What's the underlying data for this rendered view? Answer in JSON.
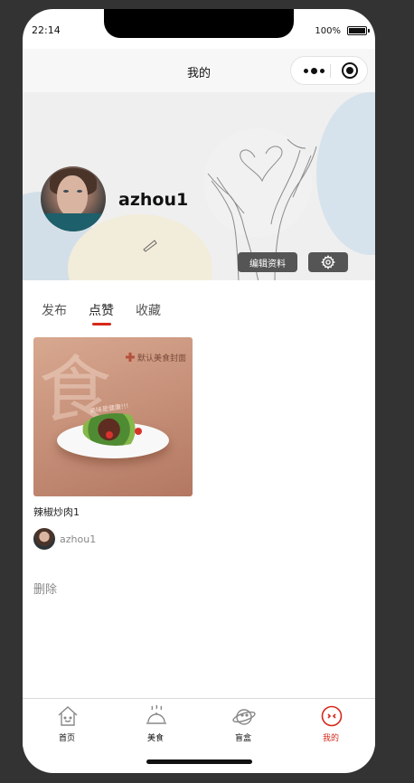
{
  "status_bar": {
    "time": "22:14",
    "battery": "100%"
  },
  "navbar": {
    "title": "我的"
  },
  "profile": {
    "username": "azhou1",
    "edit_button": "编辑资料"
  },
  "tabs": [
    {
      "label": "发布",
      "active": false
    },
    {
      "label": "点赞",
      "active": true
    },
    {
      "label": "收藏",
      "active": false
    }
  ],
  "card": {
    "image_tag": "默认美食封面",
    "image_watermark": "食",
    "image_script": "美味是健康!!!",
    "title": "辣椒炒肉1",
    "author": "azhou1"
  },
  "delete_label": "删除",
  "tabbar": [
    {
      "label": "首页",
      "icon": "home-icon",
      "active": false
    },
    {
      "label": "美食",
      "icon": "food-cover-icon",
      "active": false
    },
    {
      "label": "盲盒",
      "icon": "planet-icon",
      "active": false
    },
    {
      "label": "我的",
      "icon": "profile-face-icon",
      "active": true
    }
  ],
  "colors": {
    "accent": "#d6281b",
    "button_bg": "#555555",
    "background": "#333333"
  }
}
